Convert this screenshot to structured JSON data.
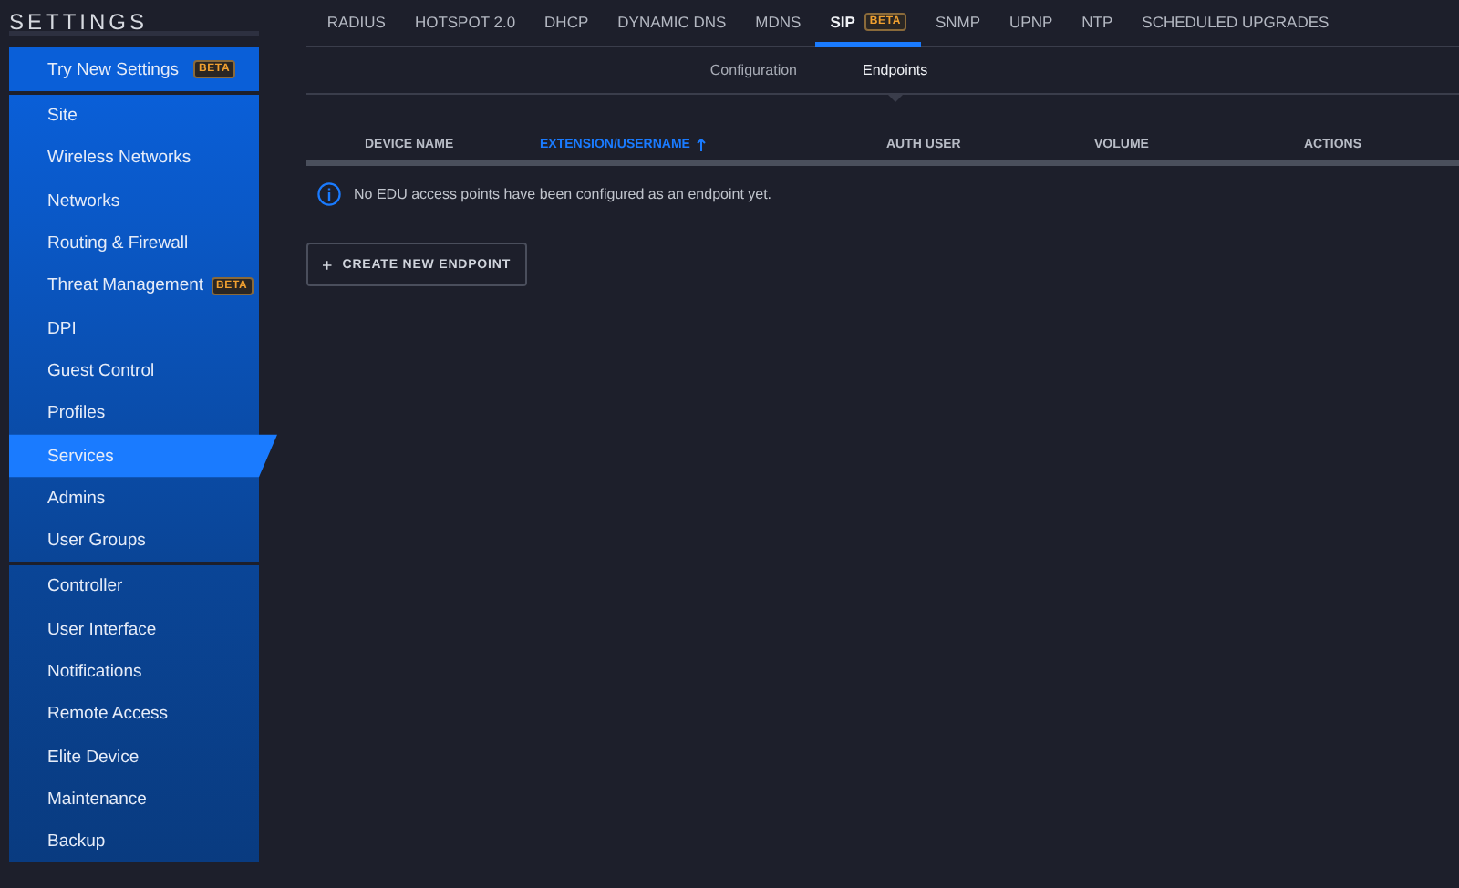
{
  "sidebar": {
    "title": "SETTINGS",
    "promo": {
      "label": "Try New Settings",
      "badge": "BETA"
    },
    "groups": [
      {
        "items": [
          {
            "label": "Site",
            "selected": false
          },
          {
            "label": "Wireless Networks",
            "selected": false
          },
          {
            "label": "Networks",
            "selected": false
          },
          {
            "label": "Routing & Firewall",
            "selected": false
          },
          {
            "label": "Threat Management",
            "badge": "BETA",
            "selected": false
          },
          {
            "label": "DPI",
            "selected": false
          },
          {
            "label": "Guest Control",
            "selected": false
          },
          {
            "label": "Profiles",
            "selected": false
          },
          {
            "label": "Services",
            "selected": true
          },
          {
            "label": "Admins",
            "selected": false
          },
          {
            "label": "User Groups",
            "selected": false
          }
        ]
      },
      {
        "items": [
          {
            "label": "Controller",
            "selected": false
          },
          {
            "label": "User Interface",
            "selected": false
          },
          {
            "label": "Notifications",
            "selected": false
          },
          {
            "label": "Remote Access",
            "selected": false
          },
          {
            "label": "Elite Device",
            "selected": false
          },
          {
            "label": "Maintenance",
            "selected": false
          },
          {
            "label": "Backup",
            "selected": false
          }
        ]
      }
    ]
  },
  "tabs": [
    {
      "label": "RADIUS",
      "selected": false
    },
    {
      "label": "HOTSPOT 2.0",
      "selected": false
    },
    {
      "label": "DHCP",
      "selected": false
    },
    {
      "label": "DYNAMIC DNS",
      "selected": false
    },
    {
      "label": "MDNS",
      "selected": false
    },
    {
      "label": "SIP",
      "badge": "BETA",
      "selected": true
    },
    {
      "label": "SNMP",
      "selected": false
    },
    {
      "label": "UPNP",
      "selected": false
    },
    {
      "label": "NTP",
      "selected": false
    },
    {
      "label": "SCHEDULED UPGRADES",
      "selected": false
    }
  ],
  "subtabs": [
    {
      "label": "Configuration",
      "selected": false
    },
    {
      "label": "Endpoints",
      "selected": true
    }
  ],
  "table": {
    "columns": [
      {
        "label": "DEVICE NAME",
        "sorted": false
      },
      {
        "label": "EXTENSION/USERNAME",
        "sorted": true
      },
      {
        "label": "AUTH USER",
        "sorted": false
      },
      {
        "label": "VOLUME",
        "sorted": false
      },
      {
        "label": "ACTIONS",
        "sorted": false
      }
    ],
    "empty_message": "No EDU access points have been configured as an endpoint yet."
  },
  "create_button": {
    "label": "CREATE NEW ENDPOINT"
  }
}
